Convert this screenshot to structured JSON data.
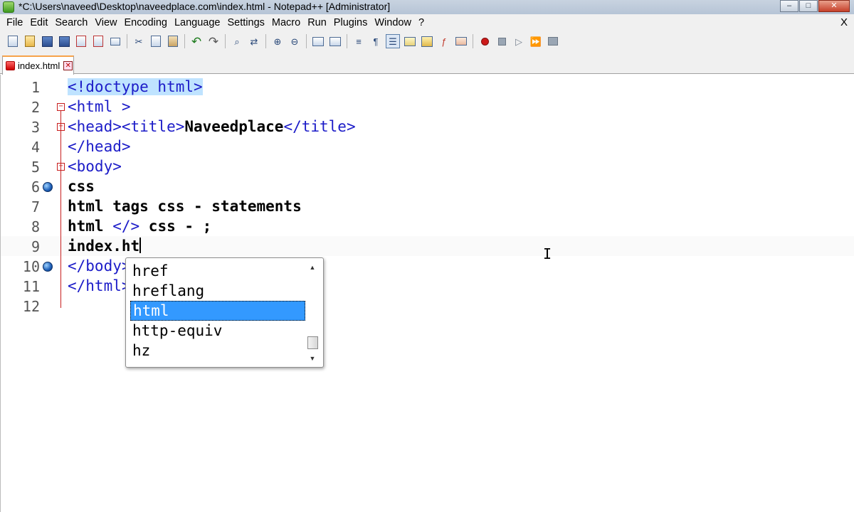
{
  "window": {
    "title": "*C:\\Users\\naveed\\Desktop\\naveedplace.com\\index.html - Notepad++ [Administrator]",
    "controls": {
      "minimize": "–",
      "maximize": "□",
      "close": "✕"
    }
  },
  "menu": {
    "items": [
      "File",
      "Edit",
      "Search",
      "View",
      "Encoding",
      "Language",
      "Settings",
      "Macro",
      "Run",
      "Plugins",
      "Window",
      "?"
    ],
    "close_doc": "X"
  },
  "toolbar": {
    "icons": [
      "new-file-icon",
      "open-file-icon",
      "save-icon",
      "save-all-icon",
      "close-icon",
      "close-all-icon",
      "print-icon",
      "cut-icon",
      "copy-icon",
      "paste-icon",
      "undo-icon",
      "redo-icon",
      "find-icon",
      "replace-icon",
      "zoom-in-icon",
      "zoom-out-icon",
      "sync-vertical-icon",
      "sync-horizontal-icon",
      "word-wrap-icon",
      "show-all-chars-icon",
      "indent-guide-icon",
      "user-lang-icon",
      "doc-map-icon",
      "function-list-icon",
      "folder-workspace-icon",
      "record-macro-icon",
      "stop-record-icon",
      "playback-macro-icon",
      "run-macro-multiple-icon",
      "save-macro-icon"
    ]
  },
  "tabs": [
    {
      "label": "index.html",
      "close": "✕"
    }
  ],
  "editor": {
    "lines": [
      {
        "num": "1",
        "parts": [
          {
            "t": "<!doctype html>",
            "c": "hl-doctype"
          }
        ]
      },
      {
        "num": "2",
        "fold": "minus",
        "parts": [
          {
            "t": "<html >",
            "c": "tag"
          }
        ]
      },
      {
        "num": "3",
        "fold": "minus",
        "parts": [
          {
            "t": "<head><title>",
            "c": "tag"
          },
          {
            "t": "Naveedplace",
            "c": "bold"
          },
          {
            "t": "</title>",
            "c": "tag"
          }
        ]
      },
      {
        "num": "4",
        "parts": [
          {
            "t": "</head>",
            "c": "tag"
          }
        ]
      },
      {
        "num": "5",
        "fold": "minus",
        "parts": [
          {
            "t": "<body>",
            "c": "tag"
          }
        ]
      },
      {
        "num": "6",
        "bookmark": true,
        "parts": [
          {
            "t": "css",
            "c": "bold"
          }
        ]
      },
      {
        "num": "7",
        "parts": [
          {
            "t": "html tags css - statements",
            "c": "bold"
          }
        ]
      },
      {
        "num": "8",
        "parts": [
          {
            "t": "html ",
            "c": "bold"
          },
          {
            "t": "</>",
            "c": "tag"
          },
          {
            "t": " css - ;",
            "c": "bold"
          }
        ]
      },
      {
        "num": "9",
        "current": true,
        "parts": [
          {
            "t": "index.ht",
            "c": "bold"
          }
        ]
      },
      {
        "num": "10",
        "bookmark": true,
        "parts": [
          {
            "t": "</body>",
            "c": "tag"
          }
        ]
      },
      {
        "num": "11",
        "parts": [
          {
            "t": "</html>",
            "c": "tag"
          }
        ]
      },
      {
        "num": "12",
        "parts": []
      }
    ]
  },
  "autocomplete": {
    "items": [
      "href",
      "hreflang",
      "html",
      "http-equiv",
      "hz"
    ],
    "selected_index": 2,
    "scroll_up": "▲",
    "scroll_down": "▼"
  },
  "cursor": {
    "glyph": "I"
  }
}
